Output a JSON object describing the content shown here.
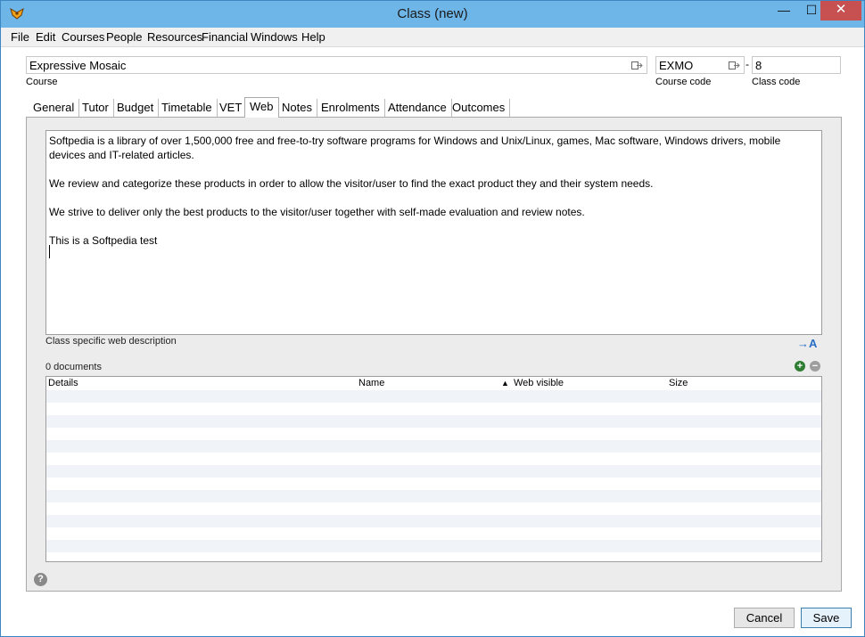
{
  "window": {
    "title": "Class (new)",
    "minimize_glyph": "—",
    "maximize_glyph": "☐",
    "close_glyph": "✕"
  },
  "menu": [
    "File",
    "Edit",
    "Courses",
    "People",
    "Resources",
    "Financial",
    "Windows",
    "Help"
  ],
  "course": {
    "name_value": "Expressive Mosaic",
    "name_label": "Course",
    "code_value": "EXMO",
    "code_label": "Course code",
    "separator": "-",
    "class_code_value": "8",
    "class_code_label": "Class code"
  },
  "tabs": [
    {
      "label": "General"
    },
    {
      "label": "Tutor"
    },
    {
      "label": "Budget"
    },
    {
      "label": "Timetable"
    },
    {
      "label": "VET"
    },
    {
      "label": "Web",
      "active": true
    },
    {
      "label": "Notes"
    },
    {
      "label": "Enrolments"
    },
    {
      "label": "Attendance"
    },
    {
      "label": "Outcomes"
    }
  ],
  "web": {
    "description_paragraphs": [
      "Softpedia is a library of over 1,500,000 free and free-to-try software programs for Windows and Unix/Linux, games, Mac software, Windows drivers, mobile devices and IT-related articles.",
      "We review and categorize these products in order to allow the visitor/user to find the exact product they and their system needs.",
      "We strive to deliver only the best products to the visitor/user together with self-made evaluation and review notes.",
      "This is a Softpedia test"
    ],
    "description_label": "Class specific web description",
    "documents_count": "0 documents",
    "columns": [
      "Details",
      "Name",
      "Web visible",
      "Size"
    ],
    "sort_indicator": "▲"
  },
  "buttons": {
    "cancel": "Cancel",
    "save": "Save",
    "help_glyph": "?",
    "add_glyph": "+",
    "remove_glyph": "−",
    "spell_glyph": "A"
  },
  "colors": {
    "titlebar": "#6fb6e8",
    "add_icon": "#2e7d32",
    "remove_icon": "#9e9e9e",
    "link_blue": "#2a6ec6"
  }
}
